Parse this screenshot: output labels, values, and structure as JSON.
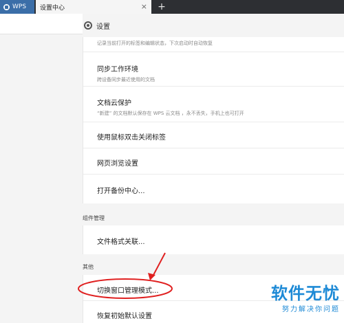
{
  "tabs": {
    "wps_label": "WPS",
    "settings_label": "设置中心",
    "close_glyph": "×",
    "add_glyph": "+"
  },
  "header": {
    "title": "设置",
    "icon": "gear-icon"
  },
  "settings": {
    "restore_desc": "记录当前打开的标签和编辑状态，下次启动时自动恢复",
    "sync_title": "同步工作环境",
    "sync_desc": "跨设备同步最近使用的文档",
    "cloud_title": "文档云保护",
    "cloud_desc": "“新建” 的文档默认保存在 WPS 云文档 ，永不丢失，手机上也可打开",
    "dblclick_title": "使用鼠标双击关闭标签",
    "browser_title": "网页浏览设置",
    "backup_title": "打开备份中心..."
  },
  "components": {
    "section_label": "组件管理",
    "file_assoc_title": "文件格式关联..."
  },
  "other": {
    "section_label": "其他",
    "switch_mode_title": "切换窗口管理模式...",
    "restore_default_title": "恢复初始默认设置"
  },
  "watermark": {
    "main": "软件无忧",
    "sub": "努力解决你问题"
  },
  "colors": {
    "tab_active_wps": "#3b6ea8",
    "annotation_red": "#e02020",
    "watermark_blue": "#1e8ad6"
  }
}
